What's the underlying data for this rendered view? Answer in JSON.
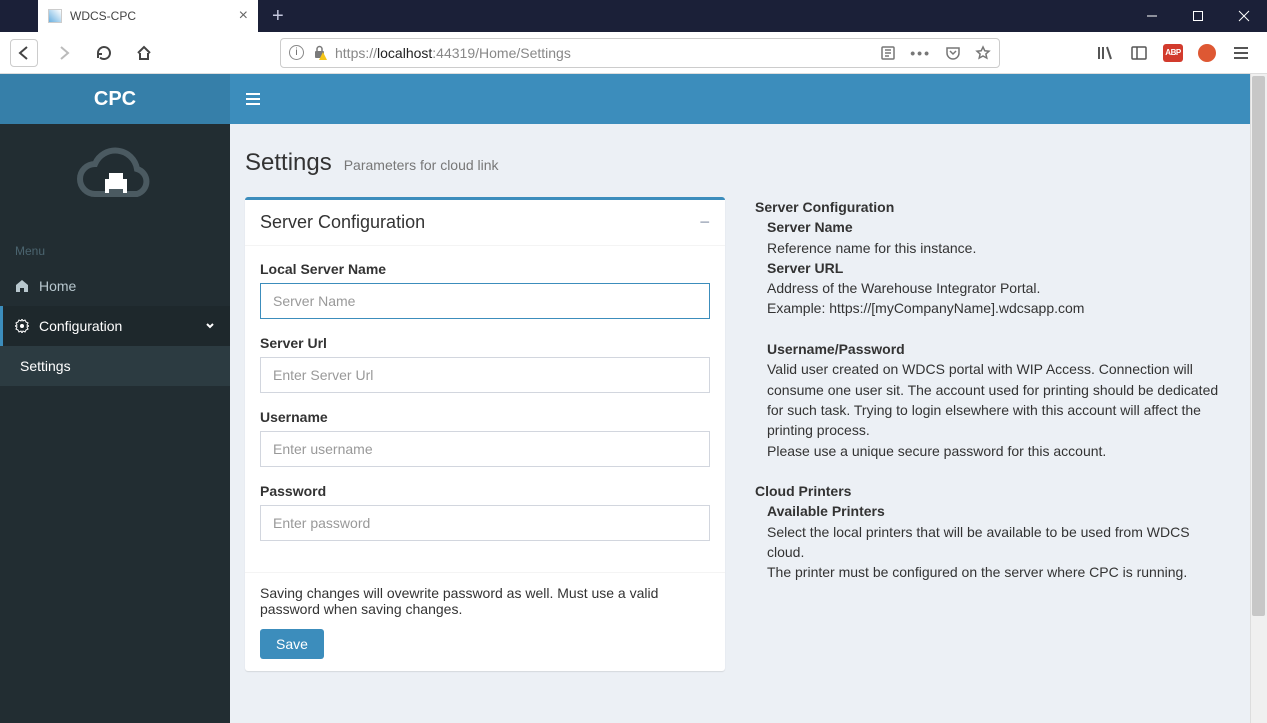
{
  "browser": {
    "tab_title": "WDCS-CPC",
    "url_prefix": "https://",
    "url_host": "localhost",
    "url_rest": ":44319/Home/Settings"
  },
  "sidebar": {
    "brand": "CPC",
    "menu_header": "Menu",
    "items": [
      "Home",
      "Configuration"
    ],
    "sub": "Settings"
  },
  "page": {
    "title": "Settings",
    "subtitle": "Parameters for cloud link"
  },
  "card": {
    "title": "Server Configuration",
    "fields": {
      "local_server_label": "Local Server Name",
      "local_server_ph": "Server Name",
      "server_url_label": "Server Url",
      "server_url_ph": "Enter Server Url",
      "username_label": "Username",
      "username_ph": "Enter username",
      "password_label": "Password",
      "password_ph": "Enter password"
    },
    "footer_note": "Saving changes will ovewrite password as well. Must use a valid password when saving changes.",
    "save": "Save"
  },
  "help": {
    "h1": "Server Configuration",
    "server_name_h": "Server Name",
    "server_name_t": "Reference name for this instance.",
    "server_url_h": "Server URL",
    "server_url_t1": "Address of the Warehouse Integrator Portal.",
    "server_url_t2": "Example: https://[myCompanyName].wdcsapp.com",
    "userpass_h": "Username/Password",
    "userpass_t1": "Valid user created on WDCS portal with WIP Access. Connection will consume one user sit. The account used for printing should be dedicated for such task. Trying to login elsewhere with this account will affect the printing process.",
    "userpass_t2": "Please use a unique secure password for this account.",
    "h2": "Cloud Printers",
    "printers_h": "Available Printers",
    "printers_t1": "Select the local printers that will be available to be used from WDCS cloud.",
    "printers_t2": "The printer must be configured on the server where CPC is running."
  }
}
